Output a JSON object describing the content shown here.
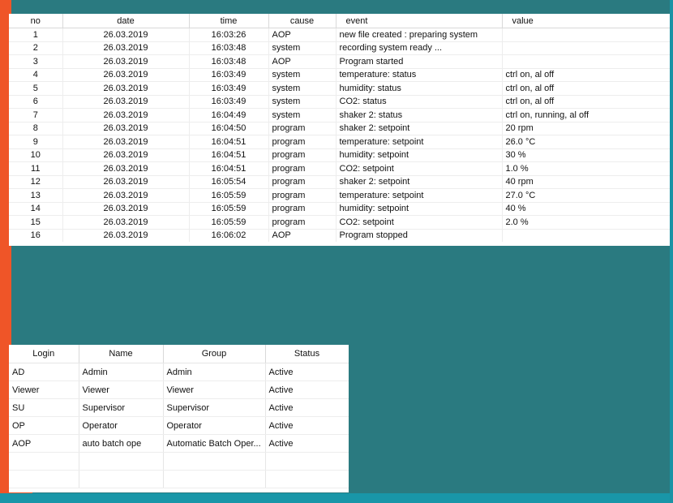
{
  "event_log": {
    "columns": {
      "no": "no",
      "date": "date",
      "time": "time",
      "cause": "cause",
      "event": "event",
      "value": "value"
    },
    "rows": [
      {
        "no": "1",
        "date": "26.03.2019",
        "time": "16:03:26",
        "cause": "AOP",
        "event": "new file created : preparing system",
        "value": ""
      },
      {
        "no": "2",
        "date": "26.03.2019",
        "time": "16:03:48",
        "cause": "system",
        "event": "recording system ready ...",
        "value": ""
      },
      {
        "no": "3",
        "date": "26.03.2019",
        "time": "16:03:48",
        "cause": "AOP",
        "event": "Program started",
        "value": ""
      },
      {
        "no": "4",
        "date": "26.03.2019",
        "time": "16:03:49",
        "cause": "system",
        "event": "temperature:  status",
        "value": "ctrl on, al off"
      },
      {
        "no": "5",
        "date": "26.03.2019",
        "time": "16:03:49",
        "cause": "system",
        "event": "humidity:  status",
        "value": "ctrl on, al off"
      },
      {
        "no": "6",
        "date": "26.03.2019",
        "time": "16:03:49",
        "cause": "system",
        "event": "CO2:  status",
        "value": "ctrl on, al off"
      },
      {
        "no": "7",
        "date": "26.03.2019",
        "time": "16:04:49",
        "cause": "system",
        "event": "shaker   2: status",
        "value": "ctrl on, running, al off"
      },
      {
        "no": "8",
        "date": "26.03.2019",
        "time": "16:04:50",
        "cause": "program",
        "event": "shaker   2: setpoint",
        "value": "20 rpm"
      },
      {
        "no": "9",
        "date": "26.03.2019",
        "time": "16:04:51",
        "cause": "program",
        "event": "temperature:  setpoint",
        "value": "26.0 °C"
      },
      {
        "no": "10",
        "date": "26.03.2019",
        "time": "16:04:51",
        "cause": "program",
        "event": "humidity:  setpoint",
        "value": "30 %"
      },
      {
        "no": "11",
        "date": "26.03.2019",
        "time": "16:04:51",
        "cause": "program",
        "event": "CO2:  setpoint",
        "value": "1.0 %"
      },
      {
        "no": "12",
        "date": "26.03.2019",
        "time": "16:05:54",
        "cause": "program",
        "event": "shaker   2: setpoint",
        "value": "40 rpm"
      },
      {
        "no": "13",
        "date": "26.03.2019",
        "time": "16:05:59",
        "cause": "program",
        "event": "temperature:  setpoint",
        "value": "27.0 °C"
      },
      {
        "no": "14",
        "date": "26.03.2019",
        "time": "16:05:59",
        "cause": "program",
        "event": "humidity:  setpoint",
        "value": "40 %"
      },
      {
        "no": "15",
        "date": "26.03.2019",
        "time": "16:05:59",
        "cause": "program",
        "event": "CO2:  setpoint",
        "value": "2.0 %"
      },
      {
        "no": "16",
        "date": "26.03.2019",
        "time": "16:06:02",
        "cause": "AOP",
        "event": "Program stopped",
        "value": ""
      }
    ]
  },
  "users": {
    "columns": {
      "login": "Login",
      "name": "Name",
      "group": "Group",
      "status": "Status"
    },
    "rows": [
      {
        "login": "AD",
        "name": "Admin",
        "group": "Admin",
        "status": "Active"
      },
      {
        "login": "Viewer",
        "name": "Viewer",
        "group": "Viewer",
        "status": "Active"
      },
      {
        "login": "SU",
        "name": "Supervisor",
        "group": "Supervisor",
        "status": "Active"
      },
      {
        "login": "OP",
        "name": "Operator",
        "group": "Operator",
        "status": "Active"
      },
      {
        "login": "AOP",
        "name": "auto batch ope",
        "group": "Automatic Batch Oper...",
        "status": "Active"
      }
    ]
  },
  "colors": {
    "background_teal": "#2e7b7f",
    "accent_orange": "#ef5528",
    "accent_cyan": "#1996a8"
  }
}
